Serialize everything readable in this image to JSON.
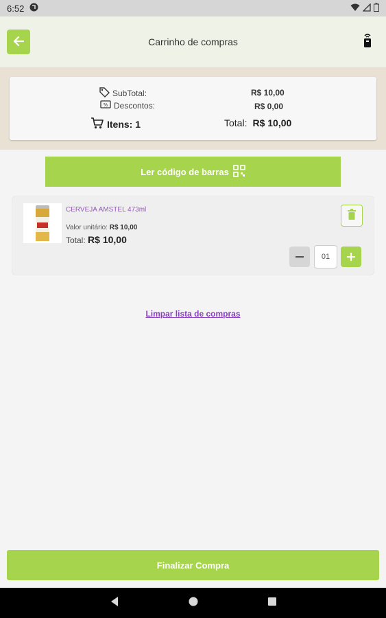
{
  "status_bar": {
    "time": "6:52"
  },
  "app_bar": {
    "title": "Carrinho de compras"
  },
  "summary": {
    "subtotal_label": "SubTotal:",
    "subtotal_value": "R$ 10,00",
    "discount_label": "Descontos:",
    "discount_value": "R$ 0,00",
    "items_label": "Itens: 1",
    "total_label": "Total:",
    "total_value": "R$ 10,00"
  },
  "barcode_button": {
    "label": "Ler código de barras"
  },
  "cart_items": [
    {
      "name": "CERVEJA AMSTEL 473ml",
      "unit_label": "Valor unitário:",
      "unit_value": "R$ 10,00",
      "total_label": "Total:",
      "total_value": "R$ 10,00",
      "quantity": "01"
    }
  ],
  "clear_link": {
    "label": "Limpar lista de compras"
  },
  "finish_button": {
    "label": "Finalizar Compra"
  },
  "colors": {
    "accent": "#a6d44d",
    "link": "#8a3fc0",
    "product_name": "#9a55c4"
  }
}
